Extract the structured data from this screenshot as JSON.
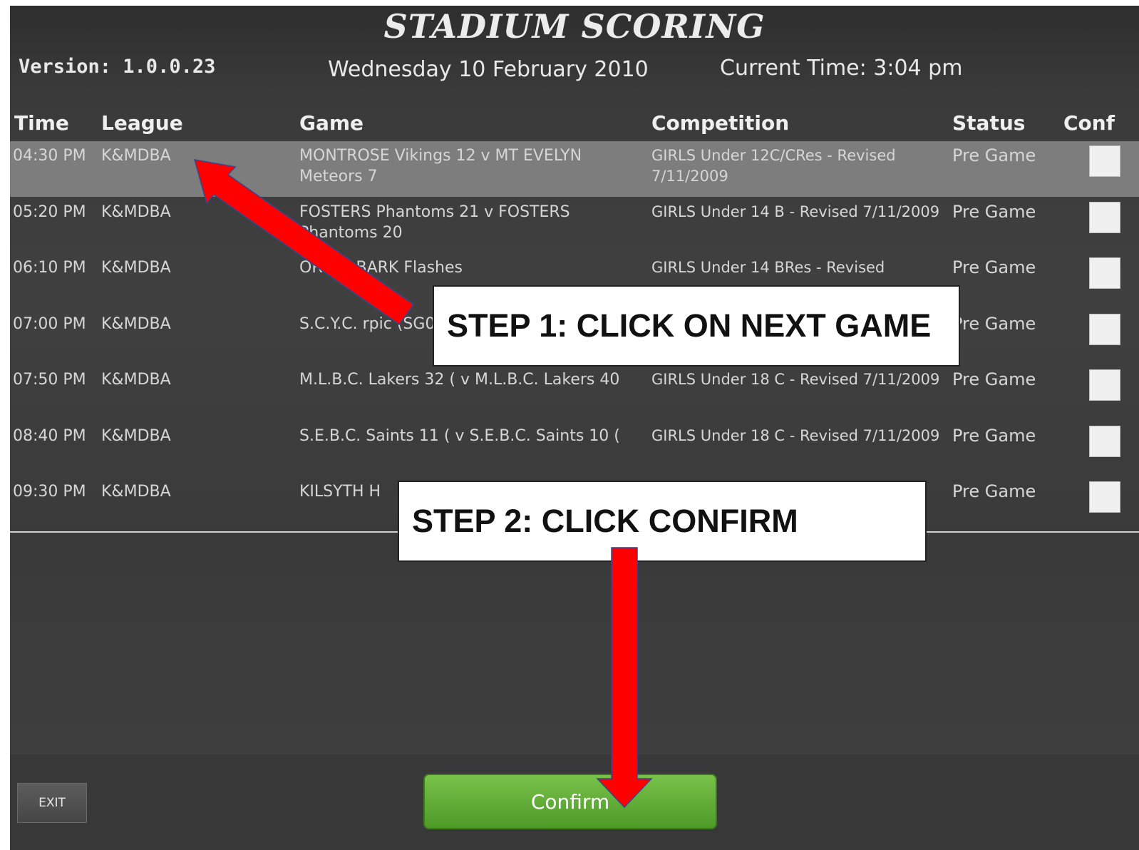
{
  "header": {
    "title": "STADIUM SCORING",
    "version": "Version: 1.0.0.23",
    "date": "Wednesday 10 February  2010",
    "current_time": "Current Time: 3:04 pm"
  },
  "table": {
    "columns": [
      "Time",
      "League",
      "Game",
      "Competition",
      "Status",
      "Conf"
    ],
    "rows": [
      {
        "time": "04:30 PM",
        "league": "K&MDBA",
        "game": "MONTROSE Vikings 12 v MT EVELYN Meteors 7",
        "competition": "GIRLS Under 12C/CRes - Revised 7/11/2009",
        "status": "Pre Game",
        "selected": true
      },
      {
        "time": "05:20 PM",
        "league": "K&MDBA",
        "game": "FOSTERS Phantoms 21 v FOSTERS Phantoms 20",
        "competition": "GIRLS Under 14 B - Revised 7/11/2009",
        "status": "Pre Game",
        "selected": false
      },
      {
        "time": "06:10 PM",
        "league": "K&MDBA",
        "game": "OROOLBARK Flashes",
        "competition": "GIRLS Under 14 BRes - Revised",
        "status": "Pre Game",
        "selected": false
      },
      {
        "time": "07:00 PM",
        "league": "K&MDBA",
        "game": "S.C.Y.C.   rpic (SG0",
        "competition": "",
        "status": "Pre Game",
        "selected": false
      },
      {
        "time": "07:50 PM",
        "league": "K&MDBA",
        "game": "M.L.B.C. Lakers 32 ( v M.L.B.C. Lakers 40",
        "competition": "GIRLS Under 18 C - Revised 7/11/2009",
        "status": "Pre Game",
        "selected": false
      },
      {
        "time": "08:40 PM",
        "league": "K&MDBA",
        "game": "S.E.B.C. Saints 11 ( v S.E.B.C. Saints 10 (",
        "competition": "GIRLS Under 18 C - Revised 7/11/2009",
        "status": "Pre Game",
        "selected": false
      },
      {
        "time": "09:30 PM",
        "league": "K&MDBA",
        "game": "KILSYTH H",
        "competition": "",
        "status": "Pre Game",
        "selected": false
      }
    ]
  },
  "footer": {
    "exit_label": "EXIT",
    "confirm_label": "Confirm"
  },
  "annotations": {
    "step1": "STEP 1: CLICK ON NEXT GAME",
    "step2": "STEP 2: CLICK CONFIRM",
    "arrow_color": "#ff0000"
  },
  "colors": {
    "selected_row": "#7d7d7d",
    "confirm_button": "#5ea832"
  }
}
